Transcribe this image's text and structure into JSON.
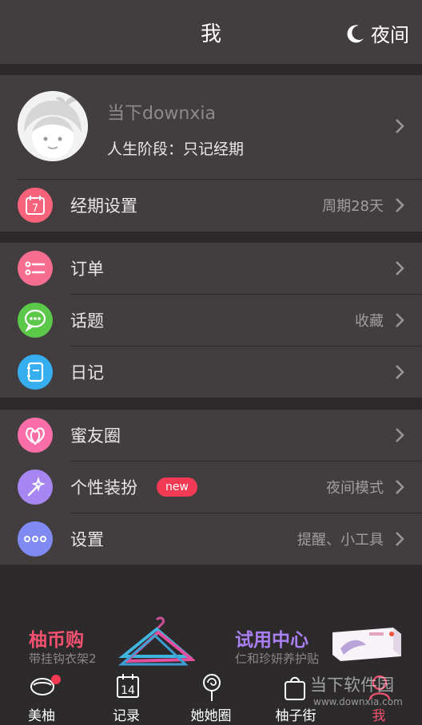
{
  "header": {
    "title": "我",
    "night_label": "夜间"
  },
  "profile": {
    "username": "当下downxia",
    "stage": "人生阶段：只记经期"
  },
  "period": {
    "label": "经期设置",
    "value": "周期28天"
  },
  "menu_group1": [
    {
      "label": "订单",
      "value": "",
      "icon": "list-icon",
      "color": "#f66e8f"
    },
    {
      "label": "话题",
      "value": "收藏",
      "icon": "chat-bubble-icon",
      "color": "#5cc84a"
    },
    {
      "label": "日记",
      "value": "",
      "icon": "notebook-icon",
      "color": "#36aef0"
    }
  ],
  "menu_group2": [
    {
      "label": "蜜友圈",
      "value": "",
      "icon": "hearts-icon",
      "color": "#f96ea7",
      "badge": ""
    },
    {
      "label": "个性装扮",
      "value": "夜间模式",
      "icon": "magic-wand-icon",
      "color": "#a686f0",
      "badge": "new"
    },
    {
      "label": "设置",
      "value": "提醒、小工具",
      "icon": "more-dots-icon",
      "color": "#7f8bf2",
      "badge": ""
    }
  ],
  "promos": [
    {
      "title": "柚币购",
      "subtitle": "带挂钩衣架2",
      "color": "#f2516f"
    },
    {
      "title": "试用中心",
      "subtitle": "仁和珍妍养护贴",
      "color": "#a97ff2"
    }
  ],
  "tabs": [
    {
      "label": "美柚",
      "icon": "bowl-icon"
    },
    {
      "label": "记录",
      "icon": "calendar-icon",
      "icon_text": "14"
    },
    {
      "label": "她她圈",
      "icon": "lollipop-icon"
    },
    {
      "label": "柚子街",
      "icon": "bag-icon"
    },
    {
      "label": "我",
      "icon": "person-icon"
    }
  ],
  "calendar_day": "7",
  "watermark": {
    "text": "当下软件园",
    "url": "www.downxia.com"
  },
  "colors": {
    "accent": "#f2516f",
    "panel": "#423e3f",
    "background": "#2d2a2b"
  }
}
